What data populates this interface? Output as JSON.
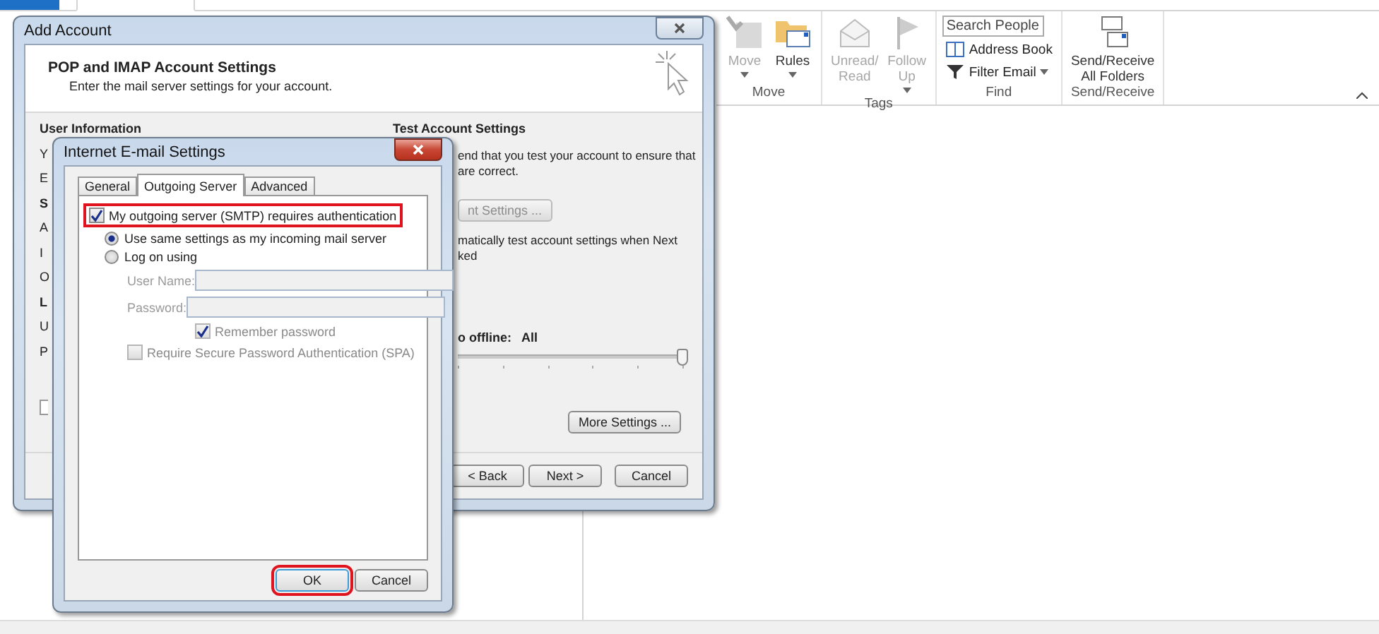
{
  "ribbon": {
    "groups": [
      {
        "label": "Move",
        "kind": "large",
        "buttons": [
          {
            "kind": "move",
            "lines": [
              "Move"
            ],
            "disabled": true,
            "dropdown": true
          },
          {
            "kind": "rules",
            "lines": [
              "Rules"
            ],
            "disabled": false,
            "dropdown": true
          }
        ]
      },
      {
        "label": "Tags",
        "kind": "large",
        "buttons": [
          {
            "kind": "unread",
            "lines": [
              "Unread/",
              "Read"
            ],
            "disabled": true,
            "dropdown": false
          },
          {
            "kind": "follow",
            "lines": [
              "Follow",
              "Up"
            ],
            "disabled": true,
            "dropdown": true
          }
        ]
      },
      {
        "label": "Find",
        "kind": "find",
        "search_placeholder": "Search People",
        "items": [
          {
            "kind": "book",
            "label": "Address Book",
            "dropdown": false
          },
          {
            "kind": "filter",
            "label": "Filter Email",
            "dropdown": true
          }
        ]
      },
      {
        "label": "Send/Receive",
        "kind": "large",
        "buttons": [
          {
            "kind": "send_receive",
            "lines": [
              "Send/Receive",
              "All Folders"
            ],
            "disabled": false,
            "dropdown": false
          }
        ]
      }
    ]
  },
  "back_dialog": {
    "title": "Add Account",
    "header_title": "POP and IMAP Account Settings",
    "header_subtitle": "Enter the mail server settings for your account.",
    "left_heading": "User Information",
    "left_labels": [
      {
        "text": "Y",
        "bold": false
      },
      {
        "text": "E",
        "bold": false
      },
      {
        "text": "S",
        "bold": true
      },
      {
        "text": "A",
        "bold": false
      },
      {
        "text": "I",
        "bold": false
      },
      {
        "text": "O",
        "bold": false
      },
      {
        "text": "L",
        "bold": true
      },
      {
        "text": "U",
        "bold": false
      },
      {
        "text": "P",
        "bold": false
      }
    ],
    "left_checkbox": {
      "checked": false
    },
    "right_heading": "Test Account Settings",
    "test_note": [
      "end that you test your account to ensure that",
      "are correct."
    ],
    "test_button": "nt Settings ...",
    "auto_test_note": [
      "matically test account settings when Next",
      "ked"
    ],
    "offline_label": "o offline:",
    "offline_value": "All",
    "offline_slider": {
      "level": 1
    },
    "more_settings": "More Settings ...",
    "buttons": [
      "< Back",
      "Next >",
      "Cancel"
    ]
  },
  "front_dialog": {
    "title": "Internet E-mail Settings",
    "tabs": [
      {
        "label": "General",
        "selected": false
      },
      {
        "label": "Outgoing Server",
        "selected": true
      },
      {
        "label": "Advanced",
        "selected": false
      }
    ],
    "auth_checkbox": {
      "label": "My outgoing server (SMTP) requires authentication",
      "checked": true,
      "highlighted": true
    },
    "radios": [
      {
        "label": "Use same settings as my incoming mail server",
        "selected": true
      },
      {
        "label": "Log on using",
        "selected": false
      }
    ],
    "fields": [
      {
        "label": "User Name:",
        "disabled": true
      },
      {
        "label": "Password:",
        "disabled": true
      }
    ],
    "remember_password": {
      "label": "Remember password",
      "checked": true,
      "disabled": true
    },
    "spa": {
      "label": "Require Secure Password Authentication (SPA)",
      "checked": false,
      "disabled": true
    },
    "buttons": [
      {
        "label": "OK",
        "highlighted": true
      },
      {
        "label": "Cancel",
        "highlighted": false
      }
    ]
  }
}
